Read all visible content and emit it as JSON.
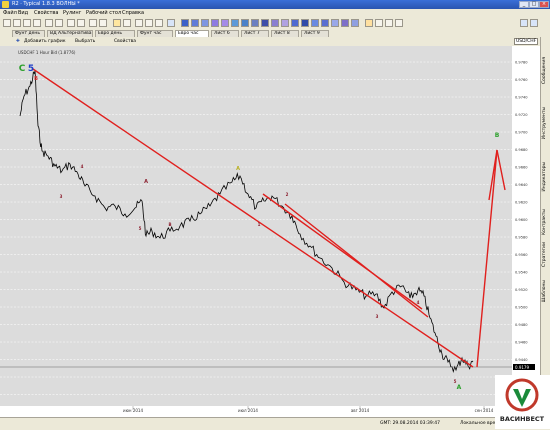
{
  "window": {
    "title": "R2 · Typical 1.8.3 ВОЛНЫ *",
    "minimize": "_",
    "maximize": "□",
    "close": "×"
  },
  "menu": [
    "Файл",
    "Вид",
    "Свойства",
    "Рулинг",
    "Рабочий стол",
    "Справка"
  ],
  "tabs": [
    "Фунт день",
    "ВД Альтернатива",
    "Евро день",
    "Фунт час",
    "Евро час",
    "Лист 6",
    "Лист 7",
    "Лист 8",
    "Лист 9"
  ],
  "active_tab_index": 4,
  "chart_toolbar": {
    "add_chart": "Добавить график",
    "select": "Выбрать",
    "properties": "Свойства"
  },
  "instrument": "USD/CHF",
  "chart_header": "USDCHF 1 Hour Bid (1.8776)",
  "side_tabs": [
    "Сообщения",
    "Инструменты",
    "Индикаторы",
    "Контракты",
    "Стратегии",
    "Шаблоны"
  ],
  "chart_data": {
    "type": "line",
    "price_axis": [
      "0.9780",
      "0.9760",
      "0.9740",
      "0.9720",
      "0.9700",
      "0.9680",
      "0.9660",
      "0.9640",
      "0.9620",
      "0.9600",
      "0.9580",
      "0.9560",
      "0.9540",
      "0.9520",
      "0.9500",
      "0.9480",
      "0.9460",
      "0.9440",
      "0.9420",
      "0.9400",
      "0.9380"
    ],
    "current_price": "0.9179",
    "time_axis": [
      "июн 2014",
      "июл 2014",
      "авг 2014",
      "сен 2014"
    ],
    "wave_labels": [
      {
        "text": "C",
        "color": "#2ca02c"
      },
      {
        "text": "5",
        "color": "#1f3fc8"
      },
      {
        "text": "B",
        "color": "#d62728"
      },
      {
        "text": "3",
        "color": "#8c2030"
      },
      {
        "text": "4",
        "color": "#8c2030"
      },
      {
        "text": "A",
        "color": "#8c2030"
      },
      {
        "text": "5",
        "color": "#8c2030"
      },
      {
        "text": "B",
        "color": "#8c2030"
      },
      {
        "text": "A",
        "color": "#b8b020"
      },
      {
        "text": "1",
        "color": "#8c2030"
      },
      {
        "text": "2",
        "color": "#8c2030"
      },
      {
        "text": "3",
        "color": "#8c2030"
      },
      {
        "text": "4",
        "color": "#8c2030"
      },
      {
        "text": "5",
        "color": "#8c2030"
      },
      {
        "text": "A",
        "color": "#2ca02c"
      },
      {
        "text": "B",
        "color": "#2ca02c"
      }
    ]
  },
  "status": {
    "time_label": "GMT: 29.08.2014 03:39:47",
    "local_label": "Локальное время:"
  },
  "logo_text": "ВАСИНВЕСТ"
}
